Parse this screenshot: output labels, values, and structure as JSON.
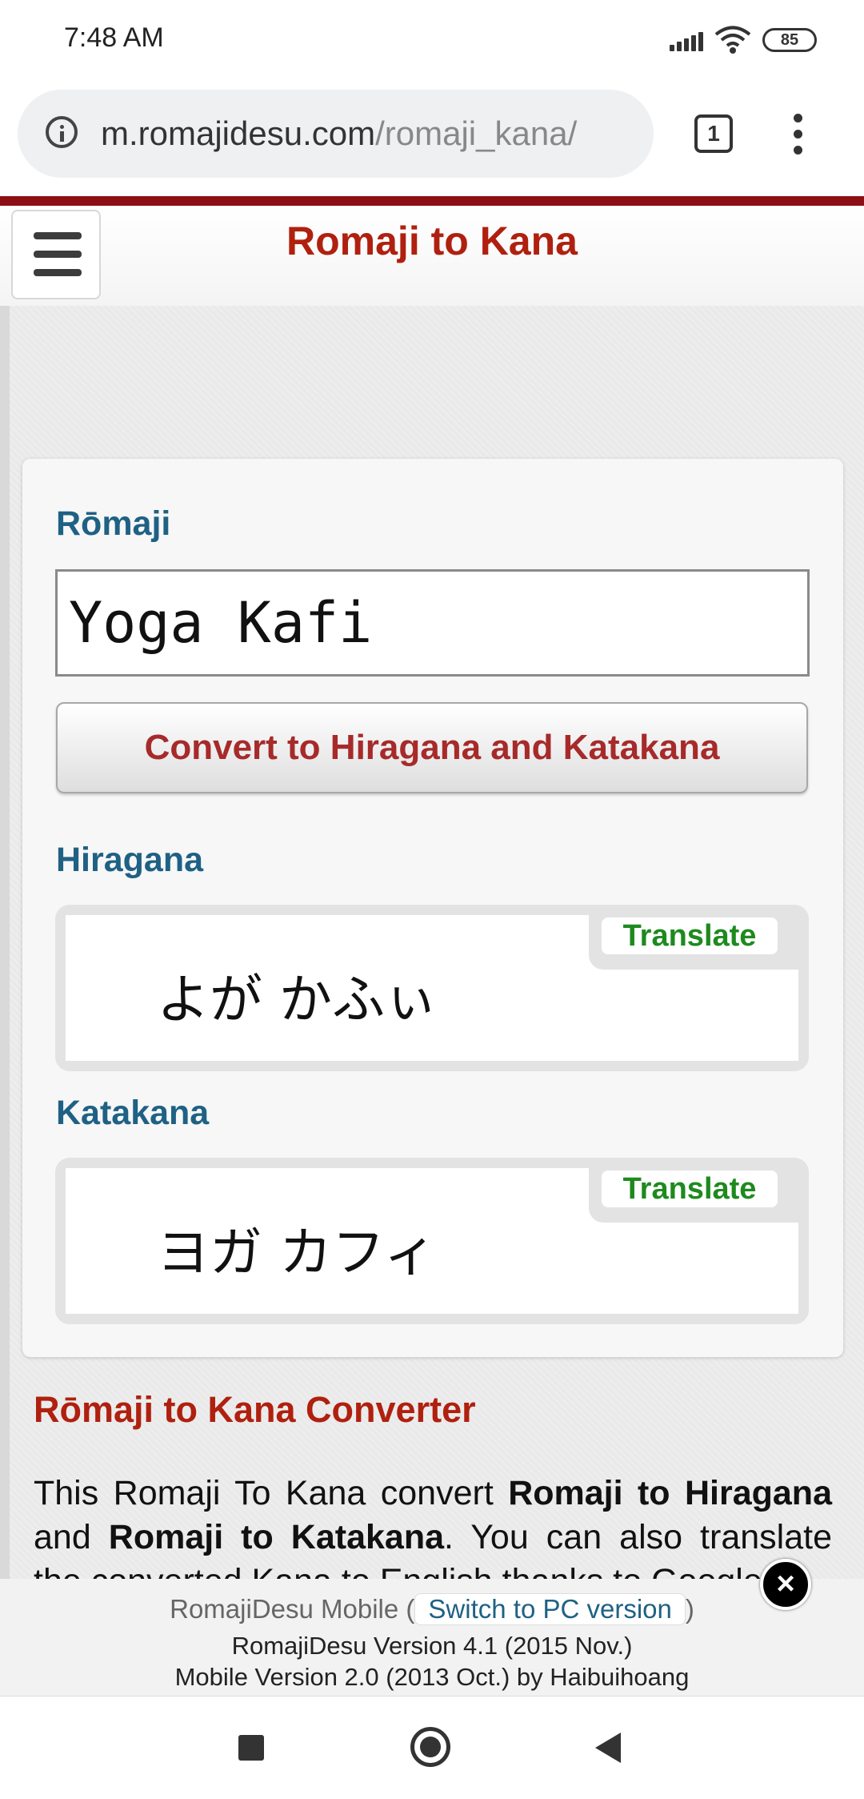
{
  "status_bar": {
    "time": "7:48 AM",
    "battery": "85",
    "icons": [
      "signal-icon",
      "wifi-icon",
      "battery-icon"
    ]
  },
  "browser": {
    "url_host": "m.romajidesu.com",
    "url_path": "/romaji_kana/",
    "tab_count": "1"
  },
  "header": {
    "title": "Romaji to Kana",
    "accent_color": "#b0200f"
  },
  "converter": {
    "romaji_label": "Rōmaji",
    "input_value": "Yoga Kafi",
    "convert_button": "Convert to Hiragana and Katakana",
    "hiragana_label": "Hiragana",
    "hiragana_result": "よが かふぃ",
    "katakana_label": "Katakana",
    "katakana_result": "ヨガ カフィ",
    "translate_label": "Translate"
  },
  "article": {
    "heading": "Rōmaji to Kana Converter",
    "text_1": "This Romaji To Kana convert ",
    "bold_1": "Romaji to Hiragana",
    "text_2": " and ",
    "bold_2": "Romaji to Katakana",
    "text_3": ". You can also translate the converted Kana to English thanks to Google"
  },
  "footer": {
    "mobile_label": "RomajiDesu Mobile",
    "switch_pc": "Switch to PC version",
    "version_line": "RomajiDesu Version 4.1 (2015 Nov.)",
    "mobile_version_line": "Mobile Version 2.0 (2013 Oct.) by Haibuihoang"
  }
}
